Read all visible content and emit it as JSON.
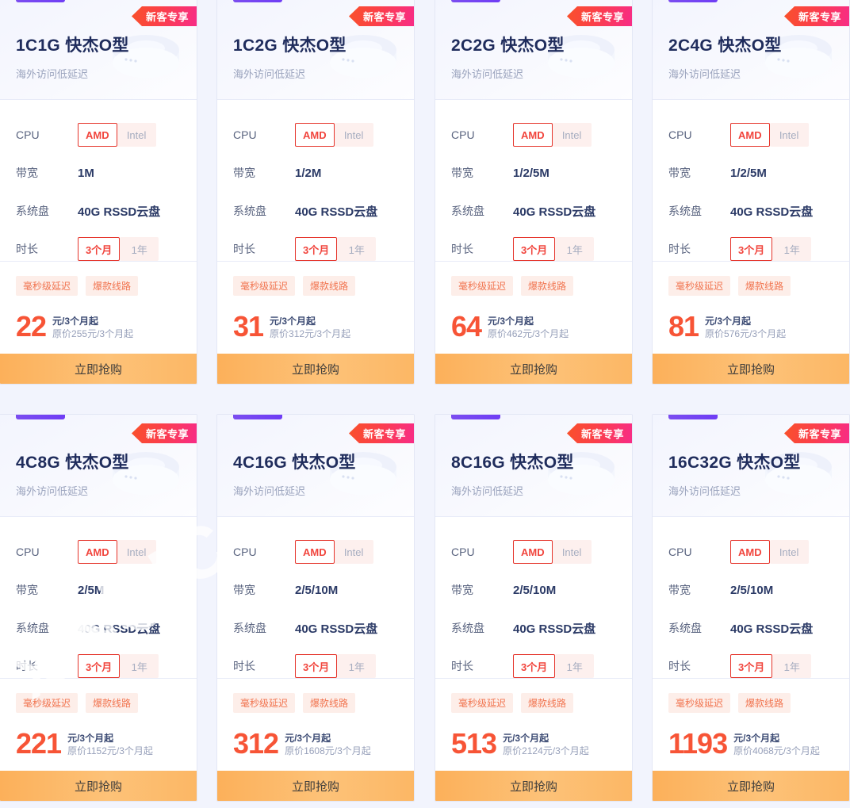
{
  "page": {
    "background_color": "#f2f4fd",
    "badge_label": "新客专享",
    "buy_label": "立即抢购",
    "subtitle": "海外访问低延迟",
    "watermark_text": "XINC",
    "accent_color": "#6f3df5",
    "price_color": "#f75436",
    "buy_color": "#fcb05a",
    "labels": {
      "cpu": "CPU",
      "bandwidth": "带宽",
      "system_disk": "系统盘",
      "duration": "时长"
    },
    "cpu_options": [
      "AMD",
      "Intel"
    ],
    "duration_options": [
      "3个月",
      "1年"
    ],
    "tags": [
      "毫秒级延迟",
      "爆款线路"
    ]
  },
  "cards": [
    {
      "title": "1C1G 快杰O型",
      "subtitle": "海外访问低延迟",
      "badge": "新客专享",
      "cpu_selected": "AMD",
      "bandwidth": "1M",
      "system_disk": "40G RSSD云盘",
      "duration_selected": "3个月",
      "tags": [
        "毫秒级延迟",
        "爆款线路"
      ],
      "price": "22",
      "price_unit": "元/3个月起",
      "original_price": "原价255元/3个月起",
      "buy_label": "立即抢购"
    },
    {
      "title": "1C2G 快杰O型",
      "subtitle": "海外访问低延迟",
      "badge": "新客专享",
      "cpu_selected": "AMD",
      "bandwidth": "1/2M",
      "system_disk": "40G RSSD云盘",
      "duration_selected": "3个月",
      "tags": [
        "毫秒级延迟",
        "爆款线路"
      ],
      "price": "31",
      "price_unit": "元/3个月起",
      "original_price": "原价312元/3个月起",
      "buy_label": "立即抢购"
    },
    {
      "title": "2C2G 快杰O型",
      "subtitle": "海外访问低延迟",
      "badge": "新客专享",
      "cpu_selected": "AMD",
      "bandwidth": "1/2/5M",
      "system_disk": "40G RSSD云盘",
      "duration_selected": "3个月",
      "tags": [
        "毫秒级延迟",
        "爆款线路"
      ],
      "price": "64",
      "price_unit": "元/3个月起",
      "original_price": "原价462元/3个月起",
      "buy_label": "立即抢购"
    },
    {
      "title": "2C4G 快杰O型",
      "subtitle": "海外访问低延迟",
      "badge": "新客专享",
      "cpu_selected": "AMD",
      "bandwidth": "1/2/5M",
      "system_disk": "40G RSSD云盘",
      "duration_selected": "3个月",
      "tags": [
        "毫秒级延迟",
        "爆款线路"
      ],
      "price": "81",
      "price_unit": "元/3个月起",
      "original_price": "原价576元/3个月起",
      "buy_label": "立即抢购"
    },
    {
      "title": "4C8G 快杰O型",
      "subtitle": "海外访问低延迟",
      "badge": "新客专享",
      "cpu_selected": "AMD",
      "bandwidth": "2/5M",
      "system_disk": "40G RSSD云盘",
      "duration_selected": "3个月",
      "tags": [
        "毫秒级延迟",
        "爆款线路"
      ],
      "price": "221",
      "price_unit": "元/3个月起",
      "original_price": "原价1152元/3个月起",
      "buy_label": "立即抢购"
    },
    {
      "title": "4C16G 快杰O型",
      "subtitle": "海外访问低延迟",
      "badge": "新客专享",
      "cpu_selected": "AMD",
      "bandwidth": "2/5/10M",
      "system_disk": "40G RSSD云盘",
      "duration_selected": "3个月",
      "tags": [
        "毫秒级延迟",
        "爆款线路"
      ],
      "price": "312",
      "price_unit": "元/3个月起",
      "original_price": "原价1608元/3个月起",
      "buy_label": "立即抢购"
    },
    {
      "title": "8C16G 快杰O型",
      "subtitle": "海外访问低延迟",
      "badge": "新客专享",
      "cpu_selected": "AMD",
      "bandwidth": "2/5/10M",
      "system_disk": "40G RSSD云盘",
      "duration_selected": "3个月",
      "tags": [
        "毫秒级延迟",
        "爆款线路"
      ],
      "price": "513",
      "price_unit": "元/3个月起",
      "original_price": "原价2124元/3个月起",
      "buy_label": "立即抢购"
    },
    {
      "title": "16C32G 快杰O型",
      "subtitle": "海外访问低延迟",
      "badge": "新客专享",
      "cpu_selected": "AMD",
      "bandwidth": "2/5/10M",
      "system_disk": "40G RSSD云盘",
      "duration_selected": "3个月",
      "tags": [
        "毫秒级延迟",
        "爆款线路"
      ],
      "price": "1193",
      "price_unit": "元/3个月起",
      "original_price": "原价4068元/3个月起",
      "buy_label": "立即抢购"
    }
  ]
}
